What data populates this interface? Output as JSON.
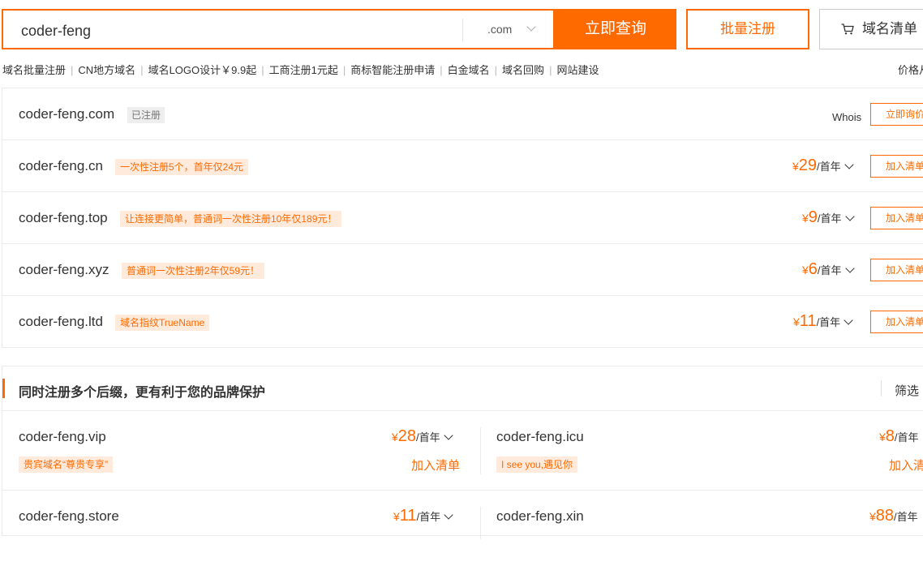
{
  "search": {
    "value": "coder-feng",
    "suffix": ".com",
    "button": "立即查询"
  },
  "bulk_button": "批量注册",
  "cart": {
    "label": "域名清单"
  },
  "links": [
    "域名批量注册",
    "CN地方域名",
    "域名LOGO设计￥9.9起",
    "工商注册1元起",
    "商标智能注册申请",
    "白金域名",
    "域名回购",
    "网站建设"
  ],
  "sort_label": "价格从",
  "results": [
    {
      "domain": "coder-feng.com",
      "status_tag": "已注册",
      "whois": "Whois",
      "action": "立即询价"
    },
    {
      "domain": "coder-feng.cn",
      "promo": "一次性注册5个，首年仅24元",
      "yen": "¥",
      "price": "29",
      "unit": "/首年",
      "action": "加入清单"
    },
    {
      "domain": "coder-feng.top",
      "promo": "让连接更简单，普通词一次性注册10年仅189元！",
      "yen": "¥",
      "price": "9",
      "unit": "/首年",
      "action": "加入清单"
    },
    {
      "domain": "coder-feng.xyz",
      "promo": "普通词一次性注册2年仅59元！",
      "yen": "¥",
      "price": "6",
      "unit": "/首年",
      "action": "加入清单"
    },
    {
      "domain": "coder-feng.ltd",
      "promo": "域名指纹TrueName",
      "yen": "¥",
      "price": "11",
      "unit": "/首年",
      "action": "加入清单"
    }
  ],
  "suggest": {
    "title": "同时注册多个后缀，更有利于您的品牌保护",
    "filter": "筛选",
    "rows": [
      [
        {
          "domain": "coder-feng.vip",
          "yen": "¥",
          "price": "28",
          "unit": "/首年",
          "promo": "贵宾域名“尊贵专享”",
          "add": "加入清单"
        },
        {
          "domain": "coder-feng.icu",
          "yen": "¥",
          "price": "8",
          "unit": "/首年",
          "promo": "I see you,遇见你",
          "add": "加入清单"
        }
      ],
      [
        {
          "domain": "coder-feng.store",
          "yen": "¥",
          "price": "11",
          "unit": "/首年"
        },
        {
          "domain": "coder-feng.xin",
          "yen": "¥",
          "price": "88",
          "unit": "/首年"
        }
      ]
    ]
  },
  "colors": {
    "accent": "#ff6a00",
    "promo_bg": "#ffeadc",
    "border": "#ebebeb"
  },
  "icons": {
    "cart": "cart-icon",
    "dropdown": "chevron-down-icon"
  }
}
